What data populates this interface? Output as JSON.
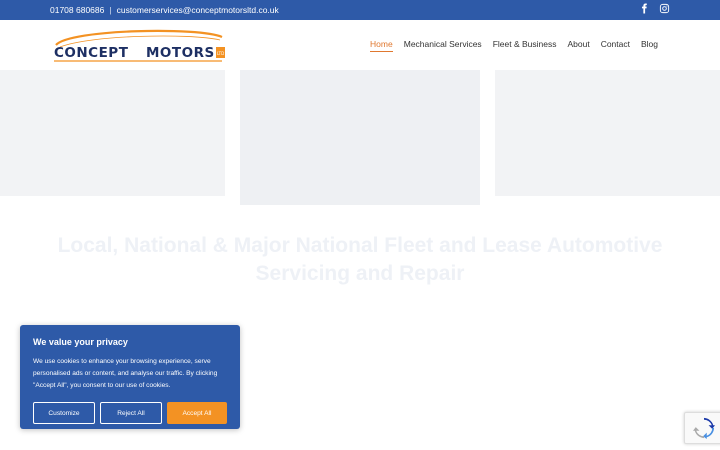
{
  "topbar": {
    "phone": "01708 680686",
    "separator": "|",
    "email": "customerservices@conceptmotorsltd.co.uk",
    "social_icons": [
      "facebook-icon",
      "instagram-icon"
    ]
  },
  "logo": {
    "text": "CONCEPT MOTORS",
    "mark": "LTD"
  },
  "nav": [
    {
      "label": "Home",
      "active": true
    },
    {
      "label": "Mechanical Services",
      "active": false
    },
    {
      "label": "Fleet & Business",
      "active": false
    },
    {
      "label": "About",
      "active": false
    },
    {
      "label": "Contact",
      "active": false
    },
    {
      "label": "Blog",
      "active": false
    }
  ],
  "cards": [
    {
      "title": "",
      "subtitle": ""
    },
    {
      "title": "",
      "subtitle": ""
    },
    {
      "title": "",
      "subtitle": ""
    }
  ],
  "hero": {
    "heading": "Local, National & Major National Fleet and Lease Automotive Servicing and Repair",
    "subheading": ""
  },
  "paragraphs": [
    "",
    "",
    "",
    ""
  ],
  "cookie": {
    "title": "We value your privacy",
    "body": "We use cookies to enhance your browsing experience, serve personalised ads or content, and analyse our traffic. By clicking \"Accept All\", you consent to our use of cookies.",
    "customize_label": "Customize",
    "reject_label": "Reject All",
    "accept_label": "Accept All"
  },
  "colors": {
    "brand_blue": "#2e5aa8",
    "accent_orange": "#e0782f",
    "accept_button": "#f39223"
  }
}
